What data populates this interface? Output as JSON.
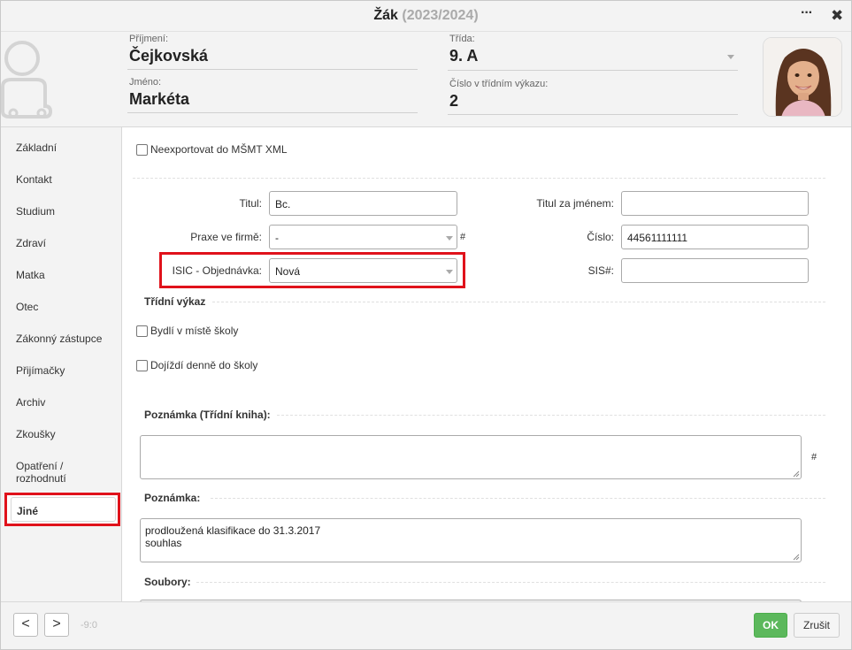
{
  "window": {
    "title": "Žák",
    "years": "(2023/2024)",
    "more_label": "···",
    "close_label": "✖"
  },
  "header": {
    "surname_label": "Příjmení:",
    "surname_value": "Čejkovská",
    "name_label": "Jméno:",
    "name_value": "Markéta",
    "class_label": "Třída:",
    "class_value": "9. A",
    "number_label": "Číslo v třídním výkazu:",
    "number_value": "2"
  },
  "sidebar": {
    "items": [
      {
        "label": "Základní"
      },
      {
        "label": "Kontakt"
      },
      {
        "label": "Studium"
      },
      {
        "label": "Zdraví"
      },
      {
        "label": "Matka"
      },
      {
        "label": "Otec"
      },
      {
        "label": "Zákonný zástupce"
      },
      {
        "label": "Přijímačky"
      },
      {
        "label": "Archiv"
      },
      {
        "label": "Zkoušky"
      },
      {
        "label": "Opatření /"
      },
      {
        "label": "rozhodnutí"
      },
      {
        "label": "Jiné"
      }
    ],
    "active": "Jiné"
  },
  "form": {
    "no_export_label": "Neexportovat do MŠMT XML",
    "titul_label": "Titul:",
    "titul_value": "Bc.",
    "titul_za_label": "Titul za jménem:",
    "titul_za_value": "",
    "praxe_label": "Praxe ve firmě:",
    "praxe_value": "-",
    "praxe_hash": "#",
    "cislo_label": "Číslo:",
    "cislo_value": "44561111111",
    "isic_label": "ISIC - Objednávka:",
    "isic_value": "Nová",
    "sis_label": "SIS#:",
    "sis_value": "",
    "tridni_vykaz_heading": "Třídní výkaz",
    "bydli_label": "Bydlí v místě školy",
    "dojizdi_label": "Dojíždí denně do školy",
    "poznamka_tk_heading": "Poznámka (Třídní kniha):",
    "poznamka_tk_value": "",
    "poznamka_tk_hash": "#",
    "poznamka_heading": "Poznámka:",
    "poznamka_line1": "prodloužená klasifikace do 31.3.2017",
    "poznamka_line2": "souhlas",
    "soubory_heading": "Soubory:"
  },
  "footer": {
    "prev_label": "<",
    "next_label": ">",
    "counter": "-9:0",
    "ok_label": "OK",
    "cancel_label": "Zrušit"
  },
  "colors": {
    "accent_ok": "#5cb85c",
    "highlight_red": "#e0121b"
  },
  "icons": [
    "user-placeholder-icon",
    "student-photo",
    "chevron-down-icon",
    "resize-grip-icon"
  ]
}
